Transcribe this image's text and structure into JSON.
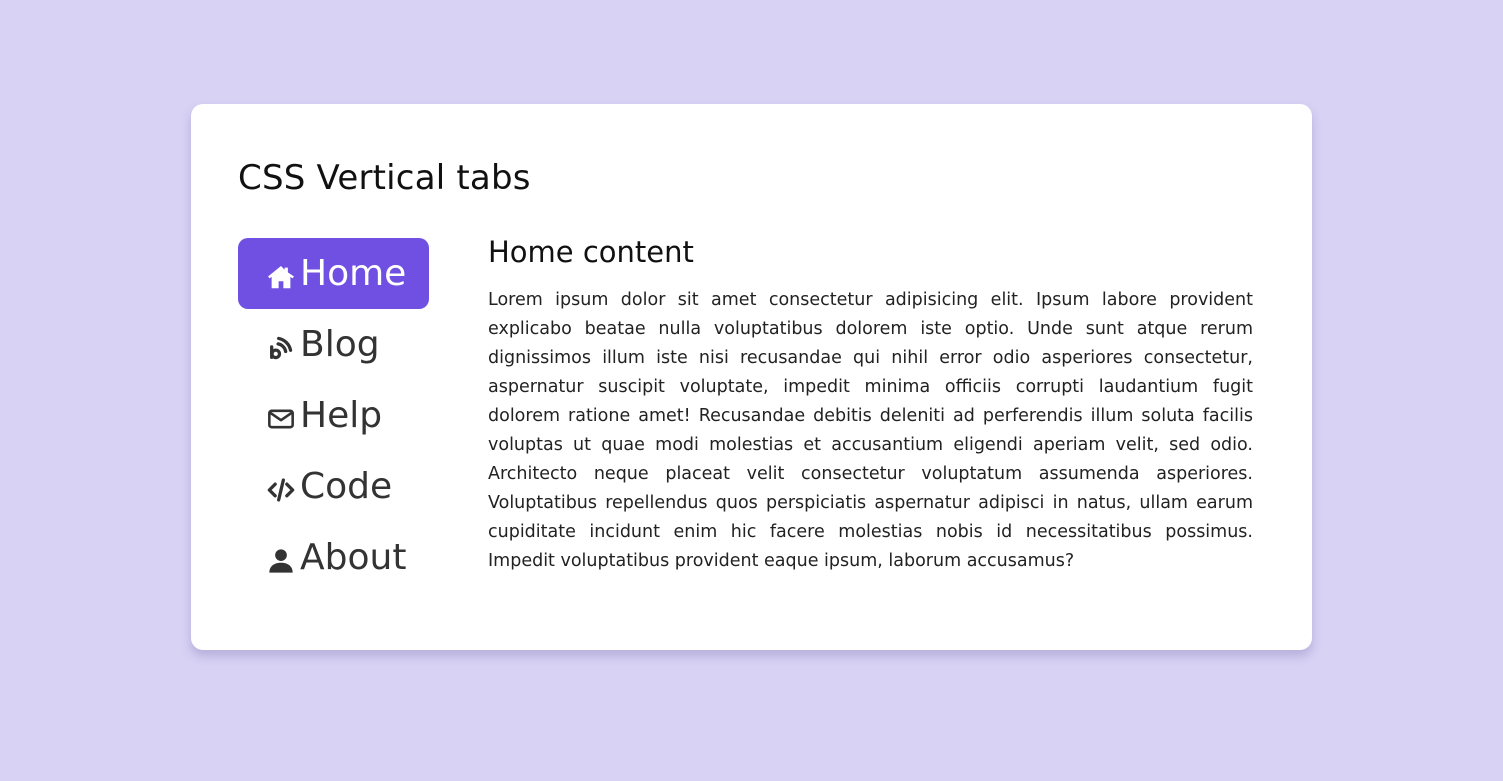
{
  "page": {
    "background_color": "#d8d2f5",
    "accent_color": "#7050e2"
  },
  "card": {
    "title": "CSS Vertical tabs"
  },
  "tabs": [
    {
      "label": "Home",
      "icon": "home-icon",
      "active": true
    },
    {
      "label": "Blog",
      "icon": "rss-icon",
      "active": false
    },
    {
      "label": "Help",
      "icon": "envelope-icon",
      "active": false
    },
    {
      "label": "Code",
      "icon": "code-icon",
      "active": false
    },
    {
      "label": "About",
      "icon": "user-icon",
      "active": false
    }
  ],
  "content": {
    "heading": "Home content",
    "body": "Lorem ipsum dolor sit amet consectetur adipisicing elit. Ipsum labore provident explicabo beatae nulla voluptatibus dolorem iste optio. Unde sunt atque rerum dignissimos illum iste nisi recusandae qui nihil error odio asperiores consectetur, aspernatur suscipit voluptate, impedit minima officiis corrupti laudantium fugit dolorem ratione amet! Recusandae debitis deleniti ad perferendis illum soluta facilis voluptas ut quae modi molestias et accusantium eligendi aperiam velit, sed odio. Architecto neque placeat velit consectetur voluptatum assumenda asperiores. Voluptatibus repellendus quos perspiciatis aspernatur adipisci in natus, ullam earum cupiditate incidunt enim hic facere molestias nobis id necessitatibus possimus. Impedit voluptatibus provident eaque ipsum, laborum accusamus?"
  }
}
